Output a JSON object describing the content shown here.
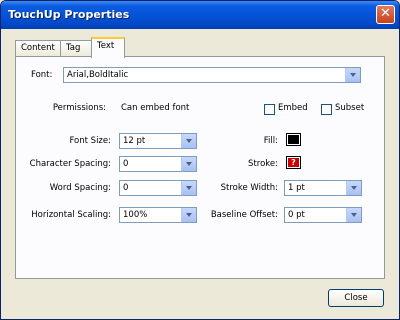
{
  "window": {
    "title": "TouchUp Properties",
    "close_glyph": "✕"
  },
  "tabs": [
    {
      "label": "Content"
    },
    {
      "label": "Tag"
    },
    {
      "label": "Text"
    }
  ],
  "active_tab": "Text",
  "font": {
    "label": "Font:",
    "value": "Arial,BoldItalic"
  },
  "permissions": {
    "label": "Permissions:",
    "value": "Can embed font"
  },
  "embed": {
    "label": "Embed",
    "checked": false
  },
  "subset": {
    "label": "Subset",
    "checked": false
  },
  "font_size": {
    "label": "Font Size:",
    "value": "12 pt"
  },
  "character_spacing": {
    "label": "Character Spacing:",
    "value": "0"
  },
  "word_spacing": {
    "label": "Word Spacing:",
    "value": "0"
  },
  "horizontal_scaling": {
    "label": "Horizontal Scaling:",
    "value": "100%"
  },
  "fill": {
    "label": "Fill:",
    "color": "#000000"
  },
  "stroke": {
    "label": "Stroke:",
    "glyph": "?"
  },
  "stroke_width": {
    "label": "Stroke Width:",
    "value": "1 pt"
  },
  "baseline_offset": {
    "label": "Baseline Offset:",
    "value": "0 pt"
  },
  "close_button": {
    "label": "Close"
  }
}
